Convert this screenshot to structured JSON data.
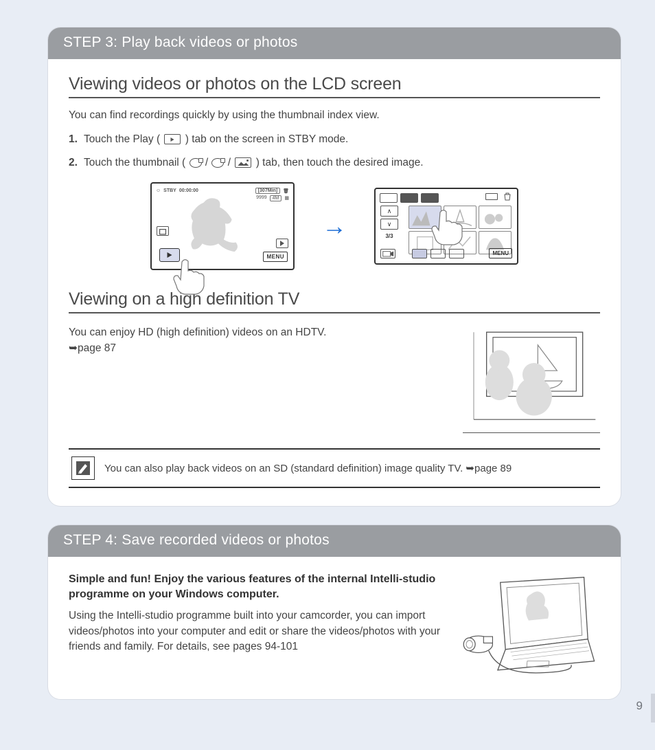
{
  "page_number": "9",
  "step3": {
    "header": "STEP 3: Play back videos or photos",
    "section1_title": "Viewing videos or photos on the LCD screen",
    "section1_intro": "You can find recordings quickly by using the thumbnail index view.",
    "steps": {
      "s1_a": "Touch the Play (",
      "s1_b": ") tab on the screen in STBY mode.",
      "s2_a": "Touch the thumbnail (",
      "s2_mid1": " / ",
      "s2_mid2": " / ",
      "s2_b": ") tab, then touch the desired image."
    },
    "lcd1": {
      "stby": "STBY",
      "time": "00:00:00",
      "remain": "[307Min]",
      "count": "9999",
      "res": "4M",
      "menu": "MENU"
    },
    "lcd2": {
      "pager": "3/3",
      "menu": "MENU"
    },
    "section2_title": "Viewing on a high definition TV",
    "section2_text": "You can enjoy HD (high definition) videos on an HDTV.",
    "section2_ref": "➥page 87",
    "note_text": "You can also play back videos on an SD (standard definition) image quality TV. ➥page 89"
  },
  "step4": {
    "header": "STEP 4: Save recorded videos or photos",
    "headline": "Simple and fun! Enjoy the various features of the internal Intelli-studio programme on your Windows computer.",
    "body": "Using the Intelli-studio programme built into your camcorder, you can import videos/photos into your computer and edit or share the videos/photos with your friends and family. For details, see pages 94-101"
  }
}
